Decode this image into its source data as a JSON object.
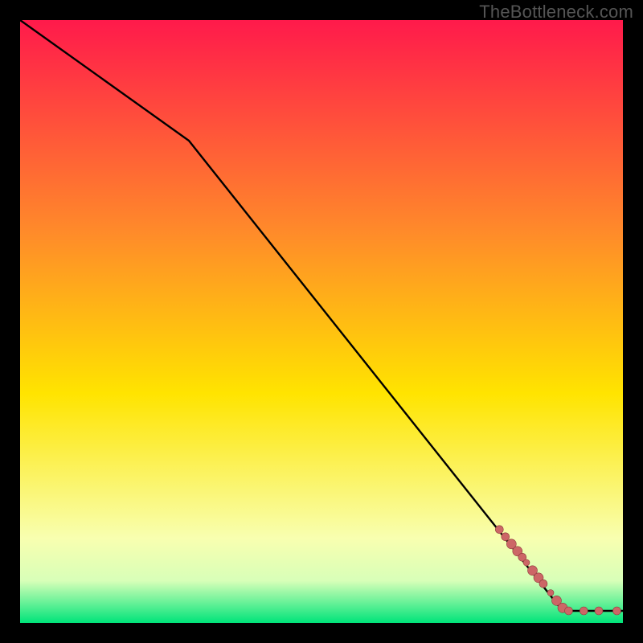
{
  "watermark": "TheBottleneck.com",
  "colors": {
    "background": "#000000",
    "gradient_top": "#ff1a4b",
    "gradient_mid_upper": "#ff8a2a",
    "gradient_mid": "#ffe400",
    "gradient_lower": "#f8ffb0",
    "gradient_bottom": "#00e47a",
    "line": "#000000",
    "markers": "#cc6666",
    "marker_stroke": "#8c3a3a"
  },
  "chart_data": {
    "type": "line",
    "title": "",
    "xlabel": "",
    "ylabel": "",
    "xlim": [
      0,
      100
    ],
    "ylim": [
      0,
      100
    ],
    "grid": false,
    "series": [
      {
        "name": "curve",
        "style": "line",
        "points": [
          {
            "x": 0,
            "y": 100
          },
          {
            "x": 28,
            "y": 80
          },
          {
            "x": 90,
            "y": 2
          },
          {
            "x": 100,
            "y": 2
          }
        ]
      },
      {
        "name": "markers",
        "style": "points",
        "points": [
          {
            "x": 79.5,
            "y": 15.5,
            "r": 5
          },
          {
            "x": 80.5,
            "y": 14.3,
            "r": 5
          },
          {
            "x": 81.5,
            "y": 13.1,
            "r": 6
          },
          {
            "x": 82.5,
            "y": 11.9,
            "r": 6
          },
          {
            "x": 83.3,
            "y": 10.9,
            "r": 5
          },
          {
            "x": 84.0,
            "y": 10.0,
            "r": 4
          },
          {
            "x": 85.0,
            "y": 8.7,
            "r": 6
          },
          {
            "x": 86.0,
            "y": 7.5,
            "r": 6
          },
          {
            "x": 86.8,
            "y": 6.5,
            "r": 5
          },
          {
            "x": 88.0,
            "y": 5.0,
            "r": 4
          },
          {
            "x": 89.0,
            "y": 3.7,
            "r": 6
          },
          {
            "x": 90.0,
            "y": 2.5,
            "r": 6
          },
          {
            "x": 91.0,
            "y": 2.0,
            "r": 5
          },
          {
            "x": 93.5,
            "y": 2.0,
            "r": 5
          },
          {
            "x": 96.0,
            "y": 2.0,
            "r": 5
          },
          {
            "x": 99.0,
            "y": 2.0,
            "r": 5
          }
        ]
      }
    ]
  }
}
